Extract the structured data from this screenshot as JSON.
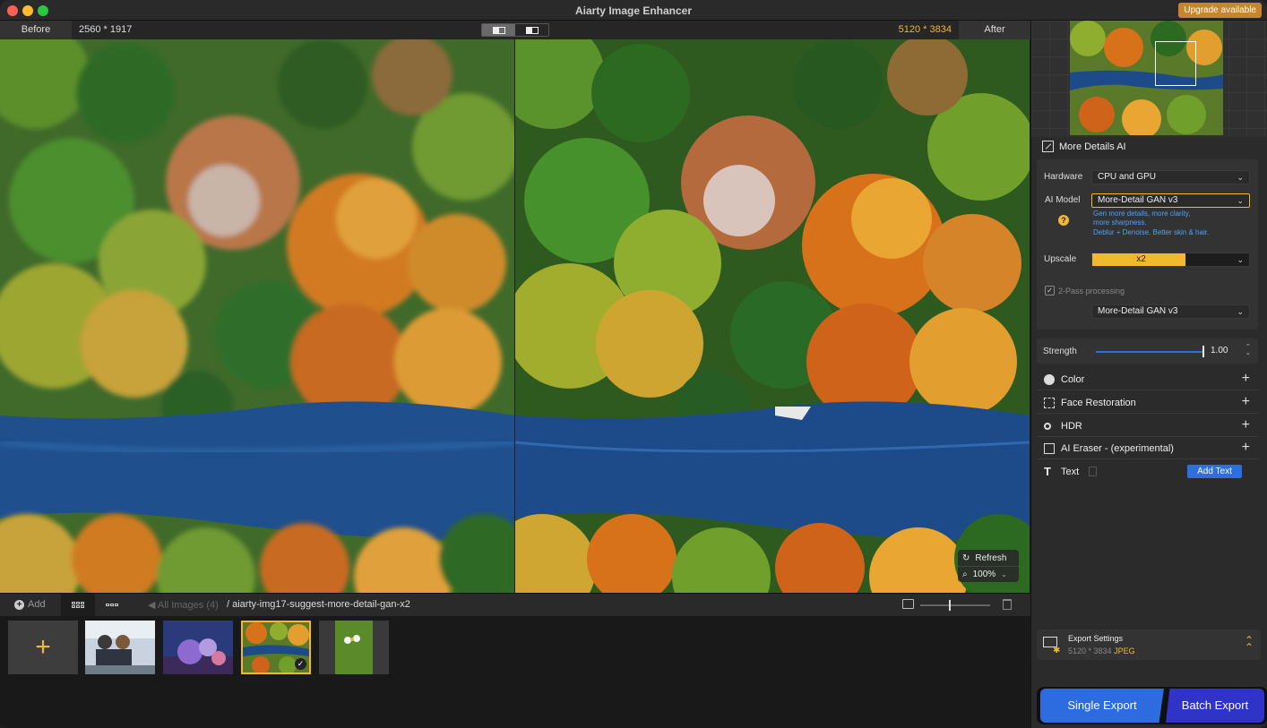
{
  "window": {
    "title": "Aiarty Image Enhancer",
    "upgrade_label": "Upgrade available"
  },
  "compare": {
    "before_label": "Before",
    "before_resolution": "2560 * 1917",
    "after_resolution": "5120 * 3834",
    "after_label": "After",
    "accent": "#f2b82e"
  },
  "overlay": {
    "refresh_label": "Refresh",
    "zoom_label": "100%"
  },
  "bottombar": {
    "add_label": "Add",
    "all_images_label": "All Images (4)",
    "breadcrumb": "/ aiarty-img17-suggest-more-detail-gan-x2"
  },
  "sidebar": {
    "mode_label": "More Details AI",
    "hardware_label": "Hardware",
    "hardware_value": "CPU and GPU",
    "model_label": "AI Model",
    "model_value": "More-Detail GAN  v3",
    "model_desc_1": "Gen more details, more clarity,",
    "model_desc_2": "more sharpness.",
    "model_desc_3": "Deblur + Denoise. Better skin & hair.",
    "upscale_label": "Upscale",
    "upscale_value": "x2",
    "two_pass_label": "2-Pass processing",
    "two_pass_model": "More-Detail GAN  v3",
    "strength_label": "Strength",
    "strength_value": "1.00",
    "features": [
      {
        "label": "Color",
        "icon": "palette-icon"
      },
      {
        "label": "Face Restoration",
        "icon": "face-scan-icon"
      },
      {
        "label": "HDR",
        "icon": "hdr-icon"
      },
      {
        "label": "AI Eraser - (experimental)",
        "icon": "eraser-icon"
      },
      {
        "label": "Text",
        "icon": "text-icon"
      }
    ],
    "add_text_label": "Add Text",
    "export": {
      "title": "Export Settings",
      "resolution": "5120 * 3834",
      "format": "JPEG"
    },
    "single_export_label": "Single Export",
    "batch_export_label": "Batch Export"
  }
}
